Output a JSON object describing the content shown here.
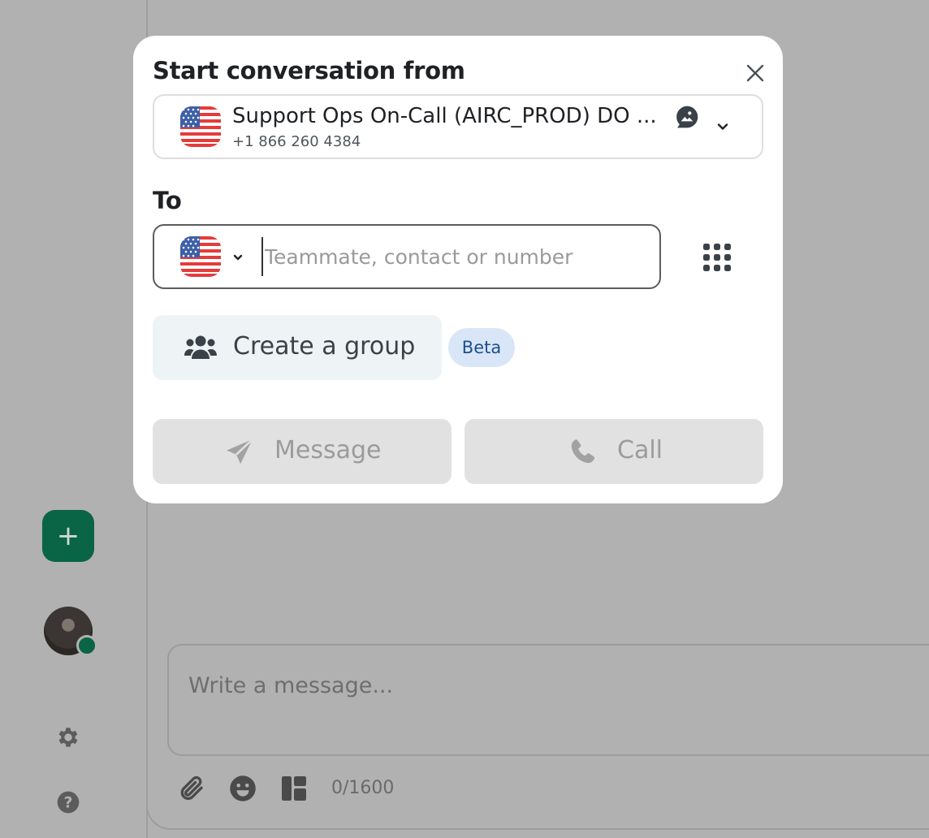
{
  "modal": {
    "title": "Start conversation from",
    "from": {
      "name": "Support Ops On-Call (AIRC_PROD) DO ...",
      "number": "+1 866 260 4384",
      "flag_icon": "us-flag-icon",
      "sms_icon": "sms-chat-icon"
    },
    "to": {
      "label": "To",
      "placeholder": "Teammate, contact or number",
      "value": ""
    },
    "group_button": {
      "label": "Create a group",
      "icon": "group-people-icon"
    },
    "beta_badge": "Beta",
    "actions": {
      "message_label": "Message",
      "call_label": "Call"
    }
  },
  "composer": {
    "placeholder": "Write a message...",
    "counter": "0/1600"
  },
  "colors": {
    "accent": "#0a6446",
    "overlay": "#b1b1b1",
    "badge_bg": "#d8e6f8",
    "badge_text": "#1d4f8c",
    "disabled_button": "#e1e1e1"
  }
}
